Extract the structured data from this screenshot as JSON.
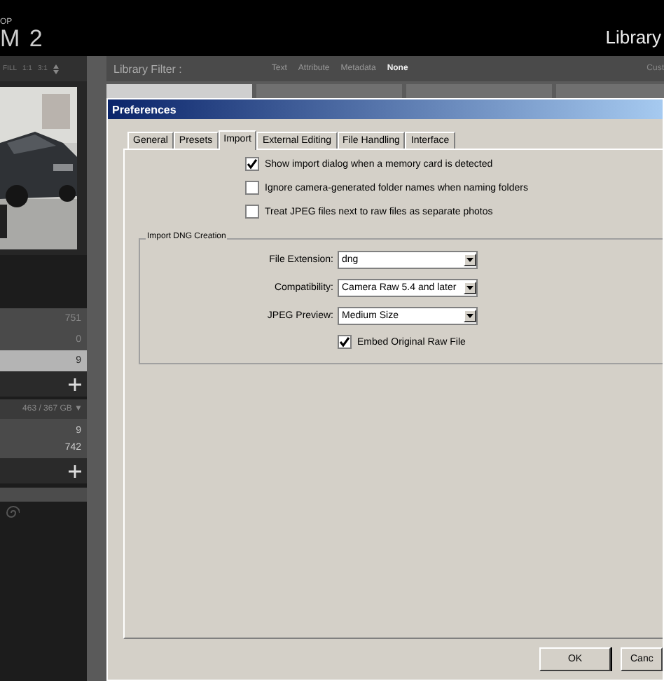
{
  "app_header": {
    "logo_small": "OP",
    "logo_large": "M 2",
    "module": "Library"
  },
  "left_panel": {
    "view_options": [
      "FILL",
      "1:1",
      "3:1"
    ],
    "preview": {
      "kind": "picture"
    },
    "counts": [
      {
        "count": "751",
        "selected": false
      },
      {
        "count": "0",
        "selected": false
      },
      {
        "count": "9",
        "selected": true
      }
    ],
    "volume": "463 / 367 GB ▼",
    "folder_counts": [
      "9",
      "742"
    ]
  },
  "filter_bar": {
    "title": "Library Filter :",
    "options": [
      {
        "label": "Text",
        "selected": false
      },
      {
        "label": "Attribute",
        "selected": false
      },
      {
        "label": "Metadata",
        "selected": false
      },
      {
        "label": "None",
        "selected": true
      }
    ],
    "custom": "Cust"
  },
  "dialog": {
    "title": "Preferences",
    "tabs": [
      {
        "label": "General",
        "selected": false
      },
      {
        "label": "Presets",
        "selected": false
      },
      {
        "label": "Import",
        "selected": true
      },
      {
        "label": "External Editing",
        "selected": false
      },
      {
        "label": "File Handling",
        "selected": false
      },
      {
        "label": "Interface",
        "selected": false
      }
    ],
    "checkboxes": [
      {
        "label": "Show import dialog when a memory card is detected",
        "checked": true
      },
      {
        "label": "Ignore camera-generated folder names when naming folders",
        "checked": false
      },
      {
        "label": "Treat JPEG files next to raw files as separate photos",
        "checked": false
      }
    ],
    "group": {
      "title": "Import DNG Creation",
      "fields": [
        {
          "label": "File Extension:",
          "value": "dng"
        },
        {
          "label": "Compatibility:",
          "value": "Camera Raw 5.4 and later"
        },
        {
          "label": "JPEG Preview:",
          "value": "Medium Size"
        }
      ],
      "embed": {
        "label": "Embed Original Raw File",
        "checked": true
      }
    },
    "buttons": [
      "OK",
      "Canc"
    ]
  }
}
